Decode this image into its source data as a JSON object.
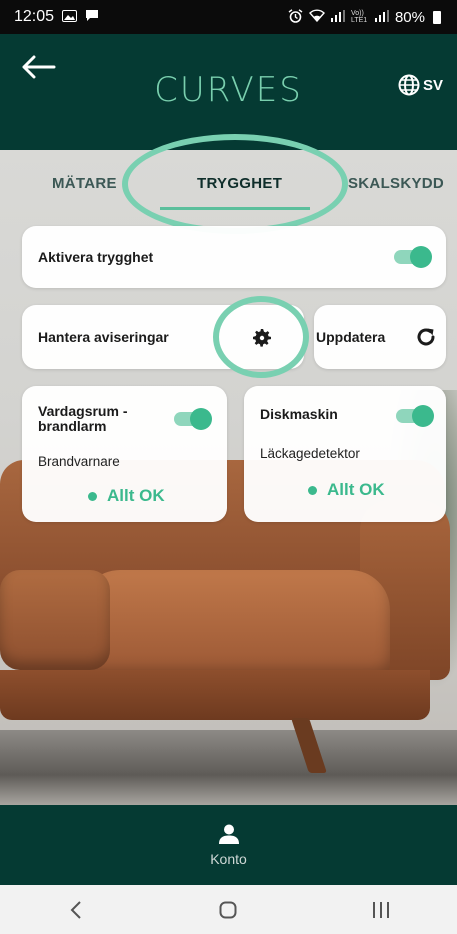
{
  "status_bar": {
    "time": "12:05",
    "network_label": "Vo)) LTE1",
    "battery": "80%"
  },
  "header": {
    "title": "CURVES",
    "language": "SV"
  },
  "tabs": [
    {
      "label": "MÄTARE",
      "active": false
    },
    {
      "label": "TRYGGHET",
      "active": true
    },
    {
      "label": "SKALSKYDD",
      "active": false
    }
  ],
  "activate_card": {
    "label": "Aktivera trygghet",
    "enabled": true
  },
  "notifications_card": {
    "label": "Hantera aviseringar"
  },
  "update_card": {
    "label": "Uppdatera"
  },
  "devices": [
    {
      "name": "Vardagsrum - brandlarm",
      "type": "Brandvarnare",
      "status": "Allt OK",
      "enabled": true
    },
    {
      "name": "Diskmaskin",
      "type": "Läckagedetektor",
      "status": "Allt OK",
      "enabled": true
    }
  ],
  "bottom_nav": {
    "account_label": "Konto"
  },
  "colors": {
    "header_bg": "#053a33",
    "accent": "#79cfae",
    "toggle_on": "#3bb98d",
    "ok_status": "#3bb98d"
  }
}
